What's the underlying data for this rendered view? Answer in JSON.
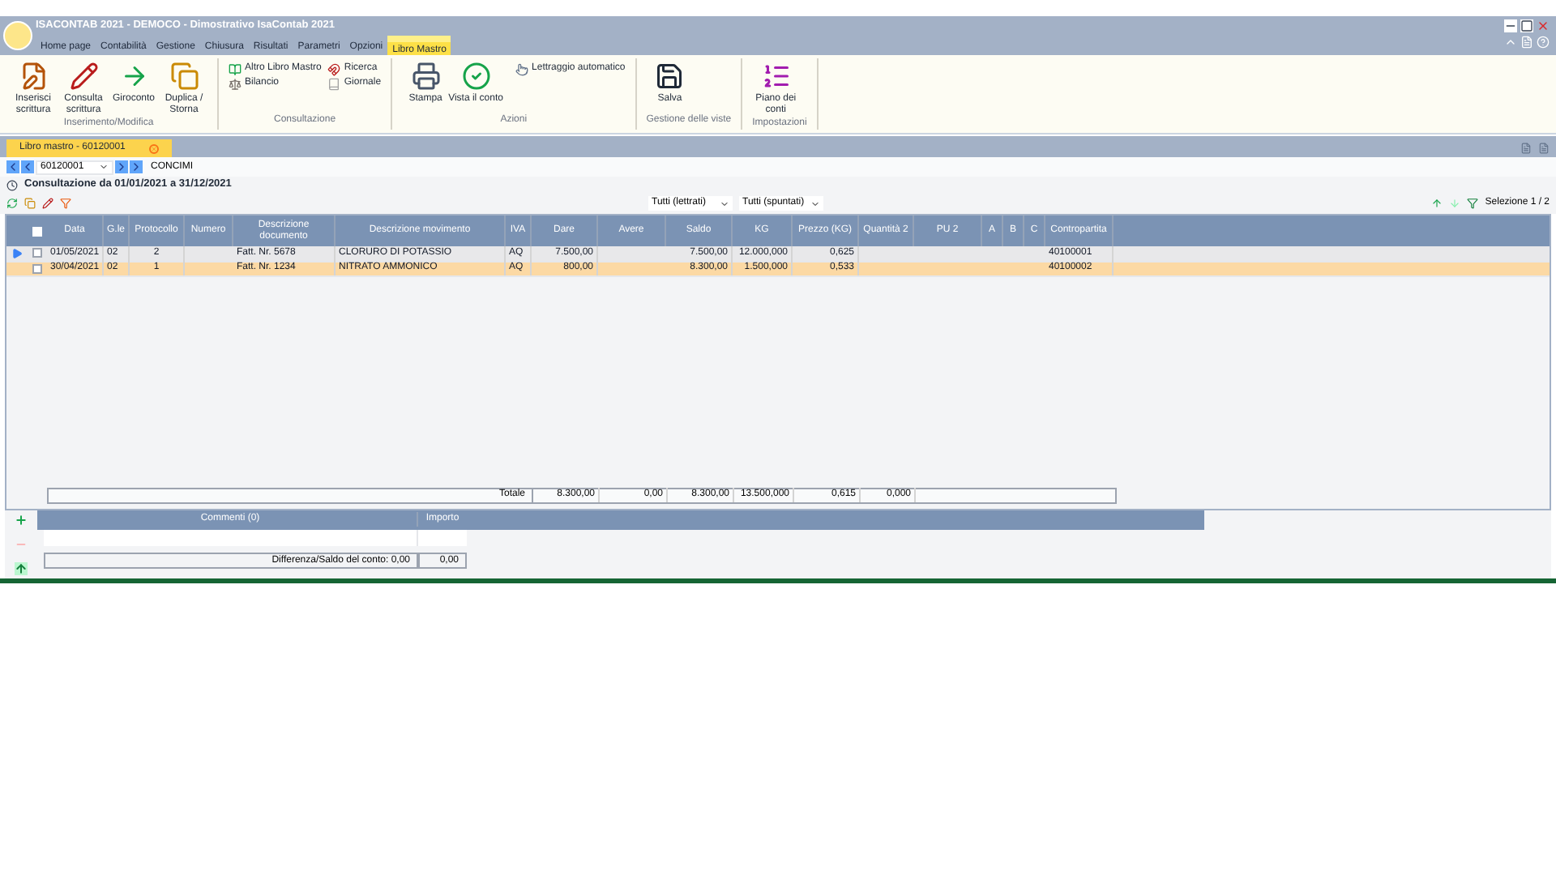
{
  "window": {
    "title": "ISACONTAB 2021 - DEMOCO - Dimostrativo IsaContab 2021"
  },
  "menu": [
    {
      "label": "Home page",
      "selected": false
    },
    {
      "label": "Contabilità",
      "selected": false
    },
    {
      "label": "Gestione",
      "selected": false
    },
    {
      "label": "Chiusura",
      "selected": false
    },
    {
      "label": "Risultati",
      "selected": false
    },
    {
      "label": "Parametri",
      "selected": false
    },
    {
      "label": "Opzioni",
      "selected": false
    },
    {
      "label": "Libro Mastro",
      "selected": true
    }
  ],
  "ribbon": [
    {
      "label": "Inserimento/Modifica",
      "kind": "large",
      "items": [
        "Inserisci scrittura",
        "Consulta scrittura",
        "Giroconto",
        "Duplica / Storna"
      ]
    },
    {
      "label": "Consultazione",
      "kind": "small",
      "items": [
        "Altro Libro Mastro",
        "Ricerca",
        "Bilancio",
        "Giornale"
      ]
    },
    {
      "label": "Azioni",
      "kind": "mixed",
      "items": [
        "Stampa",
        "Vista il conto",
        "Lettraggio automatico"
      ]
    },
    {
      "label": "Gestione delle viste",
      "kind": "large",
      "items": [
        "Salva"
      ]
    },
    {
      "label": "Impostazioni",
      "kind": "large",
      "items": [
        "Piano dei conti"
      ]
    }
  ],
  "doc_tab": {
    "label": "Libro mastro - 60120001"
  },
  "account": {
    "code": "60120001",
    "name": "CONCIMI"
  },
  "period": "Consultazione da 01/01/2021 a 31/12/2021",
  "filters": [
    "Tutti (lettrati)",
    "Tutti (spuntati)"
  ],
  "selection": "Selezione 1 / 2",
  "table": {
    "select_all_checked": false,
    "columns": [
      "Data",
      "G.le",
      "Protocollo",
      "Numero",
      "Descrizione documento",
      "Descrizione movimento",
      "IVA",
      "Dare",
      "Avere",
      "Saldo",
      "KG",
      "Prezzo (KG)",
      "Quantità 2",
      "PU 2",
      "A",
      "B",
      "C",
      "Contropartita"
    ],
    "rows": [
      {
        "current": true,
        "selected": false,
        "checked": false,
        "cells": [
          "01/05/2021",
          "02",
          "2",
          "",
          "Fatt. Nr. 5678",
          "CLORURO DI POTASSIO",
          "AQ",
          "7.500,00",
          "",
          "7.500,00",
          "12.000,000",
          "0,625",
          "",
          "",
          "",
          "",
          "",
          "40100001"
        ]
      },
      {
        "current": false,
        "selected": true,
        "checked": false,
        "cells": [
          "30/04/2021",
          "02",
          "1",
          "",
          "Fatt. Nr. 1234",
          "NITRATO AMMONICO",
          "AQ",
          "800,00",
          "",
          "8.300,00",
          "1.500,000",
          "0,533",
          "",
          "",
          "",
          "",
          "",
          "40100002"
        ]
      }
    ],
    "totals": {
      "label": "Totale",
      "cells": [
        "8.300,00",
        "0,00",
        "8.300,00",
        "13.500,000",
        "0,615",
        "0,000"
      ]
    }
  },
  "comments": {
    "columns": [
      "Commenti (0)",
      "Importo"
    ],
    "difference_label": "Differenza/Saldo del conto: 0,00",
    "difference_value": "0,00"
  }
}
